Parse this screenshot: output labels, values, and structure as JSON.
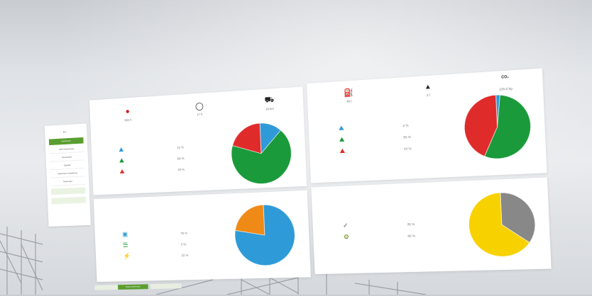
{
  "sidebar": {
    "back_icon": "arrow-left-icon",
    "items": [
      {
        "label": "Dashboard",
        "active": true
      },
      {
        "label": "GPS-Auswertung",
        "active": false
      },
      {
        "label": "Einsatzliste",
        "active": false
      },
      {
        "label": "Statistik",
        "active": false
      },
      {
        "label": "Maschinen-Auslastung",
        "active": false
      },
      {
        "label": "Tankungen",
        "active": false
      },
      {
        "label": "",
        "active": false,
        "pale": true
      },
      {
        "label": "",
        "active": false,
        "pale": true
      }
    ]
  },
  "panel_top_left": {
    "stats": [
      {
        "icon": "engine-hours-icon",
        "value": "300 h"
      },
      {
        "icon": "timer-icon",
        "value": "17 h"
      },
      {
        "icon": "distance-icon",
        "value": "18 km"
      }
    ],
    "legend": [
      {
        "icon": "excavator-blue-icon",
        "value": "12 %",
        "color": "#2f9ad8"
      },
      {
        "icon": "excavator-green-icon",
        "value": "68 %",
        "color": "#1a9a3a"
      },
      {
        "icon": "excavator-red-icon",
        "value": "20 %",
        "color": "#e02b2b"
      }
    ]
  },
  "panel_top_right": {
    "stats": [
      {
        "icon": "fuel-pump-icon",
        "value": "48 l"
      },
      {
        "icon": "emissions-icon",
        "value": "2 l"
      },
      {
        "icon": "co2-icon",
        "value": "125,5 kg"
      }
    ],
    "co2_label": "CO₂",
    "legend": [
      {
        "icon": "excavator-blue-icon",
        "value": "2 %",
        "color": "#2f9ad8"
      },
      {
        "icon": "excavator-green-icon",
        "value": "55 %",
        "color": "#1a9a3a"
      },
      {
        "icon": "excavator-red-icon",
        "value": "43 %",
        "color": "#e02b2b"
      }
    ]
  },
  "panel_bottom_left": {
    "legend": [
      {
        "icon": "monitor-icon",
        "value": "78 %",
        "color": "#2f9ad8"
      },
      {
        "icon": "list-icon",
        "value": "0 %",
        "color": "#1a9a3a"
      },
      {
        "icon": "plug-icon",
        "value": "22 %",
        "color": "#f08a16"
      }
    ]
  },
  "panel_bottom_right": {
    "legend": [
      {
        "icon": "tool-icon",
        "value": "35 %",
        "color": "#888888"
      },
      {
        "icon": "crane-icon",
        "value": "65 %",
        "color": "#f7d200"
      }
    ]
  },
  "footer": {
    "buttons": [
      "",
      "Export als Excel",
      ""
    ]
  },
  "chart_data": [
    {
      "type": "pie",
      "values": [
        12,
        68,
        20
      ],
      "colors": [
        "#2f9ad8",
        "#1a9a3a",
        "#e02b2b"
      ]
    },
    {
      "type": "pie",
      "values": [
        2,
        55,
        43
      ],
      "colors": [
        "#2f9ad8",
        "#1a9a3a",
        "#e02b2b"
      ]
    },
    {
      "type": "pie",
      "values": [
        78,
        0,
        22
      ],
      "colors": [
        "#2f9ad8",
        "#1a9a3a",
        "#f08a16"
      ]
    },
    {
      "type": "pie",
      "values": [
        35,
        65
      ],
      "colors": [
        "#888888",
        "#f7d200"
      ]
    }
  ]
}
